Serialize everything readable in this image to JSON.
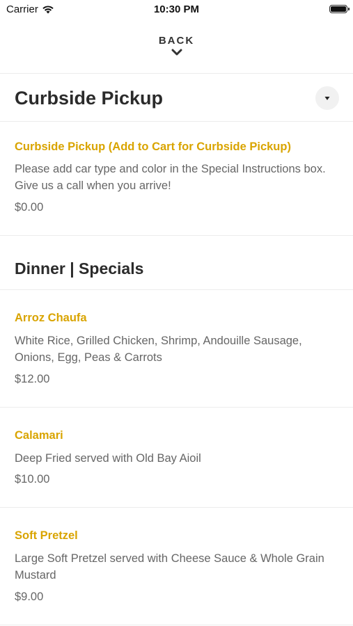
{
  "status_bar": {
    "carrier": "Carrier",
    "time": "10:30 PM"
  },
  "header": {
    "back_label": "BACK"
  },
  "sections": [
    {
      "title": "Curbside Pickup",
      "items": [
        {
          "name": "Curbside Pickup (Add to Cart for Curbside Pickup)",
          "description": "Please add car type and color in the Special Instructions box. Give us a call when you arrive!",
          "price": "$0.00"
        }
      ]
    },
    {
      "title": "Dinner | Specials",
      "items": [
        {
          "name": "Arroz Chaufa",
          "description": "White Rice, Grilled Chicken, Shrimp, Andouille Sausage, Onions, Egg, Peas & Carrots",
          "price": "$12.00"
        },
        {
          "name": "Calamari",
          "description": "Deep Fried served with Old Bay Aioil",
          "price": "$10.00"
        },
        {
          "name": "Soft Pretzel",
          "description": "Large Soft Pretzel served with Cheese Sauce & Whole Grain Mustard",
          "price": "$9.00"
        }
      ]
    }
  ],
  "colors": {
    "item_name": "#d9a400",
    "text_secondary": "#666666",
    "divider": "#ececec"
  },
  "icons": [
    "wifi-icon",
    "battery-icon",
    "chevron-down-icon",
    "dropdown-caret-icon"
  ]
}
